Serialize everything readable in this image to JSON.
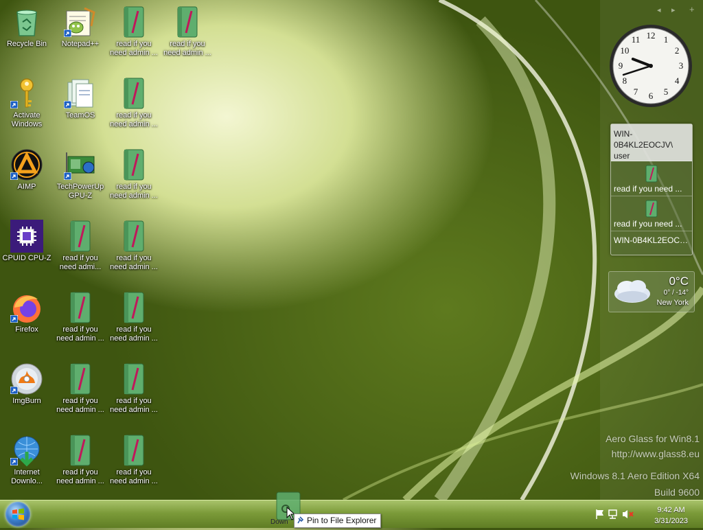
{
  "desktop": {
    "icons": [
      {
        "label": "Recycle Bin",
        "kind": "recycle-bin-icon"
      },
      {
        "label": "Notepad++",
        "kind": "notepadpp-icon"
      },
      {
        "label": "read if you need admin ...",
        "kind": "book-icon"
      },
      {
        "label": "read if you need admin ...",
        "kind": "book-icon"
      },
      {
        "label": "Activate Windows",
        "kind": "key-icon"
      },
      {
        "label": "TeamOS",
        "kind": "files-icon"
      },
      {
        "label": "read if you need admin ...",
        "kind": "book-icon"
      },
      {
        "label": "AIMP",
        "kind": "aimp-icon"
      },
      {
        "label": "TechPowerUp GPU-Z",
        "kind": "gpuz-icon"
      },
      {
        "label": "read if you need admin ...",
        "kind": "book-icon"
      },
      {
        "label": "CPUID CPU-Z",
        "kind": "cpuz-icon"
      },
      {
        "label": "read if you need admi...",
        "kind": "book-icon"
      },
      {
        "label": "read if you need admin ...",
        "kind": "book-icon"
      },
      {
        "label": "Firefox",
        "kind": "firefox-icon"
      },
      {
        "label": "read if you need admin ...",
        "kind": "book-icon"
      },
      {
        "label": "read if you need admin ...",
        "kind": "book-icon"
      },
      {
        "label": "ImgBurn",
        "kind": "imgburn-icon"
      },
      {
        "label": "read if you need admin ...",
        "kind": "book-icon"
      },
      {
        "label": "read if you need admin ...",
        "kind": "book-icon"
      },
      {
        "label": "Internet Downlo...",
        "kind": "idm-icon"
      },
      {
        "label": "read if you need admin ...",
        "kind": "book-icon"
      },
      {
        "label": "read if you need admin ...",
        "kind": "book-icon"
      }
    ]
  },
  "gadgets": {
    "nav": {
      "prev": "◂",
      "next": "▸",
      "add": "+"
    },
    "clock": {
      "hour": 9,
      "minute": 42
    },
    "recent": {
      "user": "WIN-0B4KL2EOCJV\\ user",
      "file1": "read if you need ...",
      "file2": "read if you need ...",
      "computer": "WIN-0B4KL2EOCJV"
    },
    "weather": {
      "temp": "0°C",
      "range": "0° / -14°",
      "city": "New York"
    }
  },
  "watermark": {
    "line1": "Aero Glass for Win8.1",
    "line2": "http://www.glass8.eu",
    "line3": "Windows 8.1 Aero Edition X64",
    "line4": "Build 9600"
  },
  "taskbar": {
    "time": "9:42 AM",
    "date": "3/31/2023",
    "drag_label": "Down",
    "tooltip": "Pin to File Explorer"
  },
  "colors": {
    "book_green": "#5fae6e",
    "book_spine": "#c0185a",
    "taskbar": "#7c9b3a"
  }
}
